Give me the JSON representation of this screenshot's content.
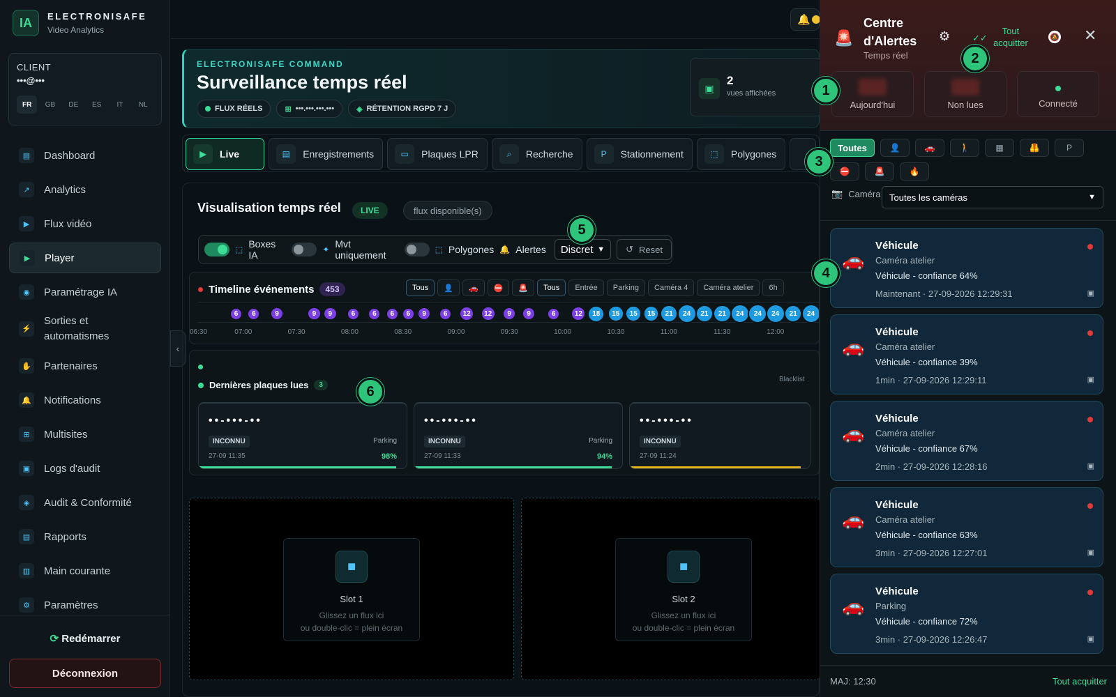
{
  "brand": {
    "logo": "IA",
    "name": "ELECTRONISAFE",
    "sub": "Video Analytics"
  },
  "client": {
    "label": "CLIENT",
    "email": "•••@•••",
    "languages": [
      "FR",
      "GB",
      "DE",
      "ES",
      "IT",
      "NL"
    ]
  },
  "nav": [
    {
      "label": "Dashboard",
      "icon": "dashboard-icon",
      "glyph": "▤"
    },
    {
      "label": "Analytics",
      "icon": "analytics-icon",
      "glyph": "↗"
    },
    {
      "label": "Flux vidéo",
      "icon": "video-icon",
      "glyph": "▶"
    },
    {
      "label": "Player",
      "icon": "play-icon",
      "glyph": "▶"
    },
    {
      "label": "Paramétrage IA",
      "icon": "brain-icon",
      "glyph": "◉"
    },
    {
      "label": "Sorties et automatismes",
      "icon": "bolt-icon",
      "glyph": "⚡"
    },
    {
      "label": "Partenaires",
      "icon": "handshake-icon",
      "glyph": "✋"
    },
    {
      "label": "Notifications",
      "icon": "bell-icon",
      "glyph": "🔔"
    },
    {
      "label": "Multisites",
      "icon": "sitemap-icon",
      "glyph": "⊞"
    },
    {
      "label": "Logs d'audit",
      "icon": "log-icon",
      "glyph": "▣"
    },
    {
      "label": "Audit & Conformité",
      "icon": "shield-icon",
      "glyph": "◈"
    },
    {
      "label": "Rapports",
      "icon": "report-icon",
      "glyph": "▤"
    },
    {
      "label": "Main courante",
      "icon": "book-icon",
      "glyph": "▥"
    },
    {
      "label": "Paramètres",
      "icon": "gear-icon",
      "glyph": "⚙"
    }
  ],
  "footer": {
    "restart": "Redémarrer",
    "logout": "Déconnexion"
  },
  "hero": {
    "kicker": "ELECTRONISAFE COMMAND",
    "title": "Surveillance temps réel",
    "chips": [
      "FLUX RÉELS",
      "•••.•••.•••.•••",
      "RÉTENTION RGPD 7 J"
    ],
    "views_count": "2",
    "views_label": "vues affichées"
  },
  "tabs": [
    {
      "label": "Live",
      "glyph": "▶"
    },
    {
      "label": "Enregistrements",
      "glyph": "▤"
    },
    {
      "label": "Plaques LPR",
      "glyph": "▭"
    },
    {
      "label": "Recherche",
      "glyph": "⌕"
    },
    {
      "label": "Stationnement",
      "glyph": "P"
    },
    {
      "label": "Polygones",
      "glyph": "⬚"
    }
  ],
  "viz": {
    "title": "Visualisation temps réel",
    "live": "LIVE",
    "flux": "flux disponible(s)"
  },
  "controls": {
    "boxes": "Boxes IA",
    "mvt": "Mvt uniquement",
    "polygones": "Polygones",
    "alertes": "Alertes",
    "mode": "Discret",
    "reset": "Reset"
  },
  "timeline": {
    "title": "Timeline événements",
    "count": "453",
    "filters": [
      "Tous",
      "👤",
      "🚗",
      "⛔",
      "🚨",
      "Tous",
      "Entrée",
      "Parking",
      "Caméra 4",
      "Caméra atelier",
      "6h"
    ],
    "ticks": [
      "06:30",
      "07:00",
      "07:30",
      "08:00",
      "08:30",
      "09:00",
      "09:30",
      "10:00",
      "10:30",
      "11:00",
      "11:30",
      "12:00"
    ],
    "events": [
      {
        "t": "06:42",
        "n": "6",
        "c": "#7b3fe4"
      },
      {
        "t": "06:52",
        "n": "6",
        "c": "#7b3fe4"
      },
      {
        "t": "07:05",
        "n": "9",
        "c": "#7b3fe4"
      },
      {
        "t": "07:26",
        "n": "9",
        "c": "#7b3fe4"
      },
      {
        "t": "07:35",
        "n": "9",
        "c": "#7b3fe4"
      },
      {
        "t": "07:48",
        "n": "6",
        "c": "#7b3fe4"
      },
      {
        "t": "08:00",
        "n": "6",
        "c": "#7b3fe4"
      },
      {
        "t": "08:10",
        "n": "6",
        "c": "#7b3fe4"
      },
      {
        "t": "08:19",
        "n": "6",
        "c": "#7b3fe4"
      },
      {
        "t": "08:28",
        "n": "9",
        "c": "#7b3fe4"
      },
      {
        "t": "08:40",
        "n": "6",
        "c": "#7b3fe4"
      },
      {
        "t": "08:52",
        "n": "12",
        "c": "#7b3fe4"
      },
      {
        "t": "09:04",
        "n": "12",
        "c": "#7b3fe4"
      },
      {
        "t": "09:16",
        "n": "9",
        "c": "#7b3fe4"
      },
      {
        "t": "09:27",
        "n": "9",
        "c": "#7b3fe4"
      },
      {
        "t": "09:41",
        "n": "6",
        "c": "#7b3fe4"
      },
      {
        "t": "09:55",
        "n": "12",
        "c": "#7b3fe4"
      },
      {
        "t": "10:05",
        "n": "18",
        "c": "#7b3fe4"
      },
      {
        "t": "10:16",
        "n": "15",
        "c": "#7b3fe4"
      },
      {
        "t": "10:26",
        "n": "15",
        "c": "#7b3fe4"
      },
      {
        "t": "10:36",
        "n": "15",
        "c": "#7b3fe4"
      },
      {
        "t": "10:46",
        "n": "21",
        "c": "#7b3fe4"
      },
      {
        "t": "10:56",
        "n": "24",
        "c": "#7b3fe4"
      },
      {
        "t": "11:06",
        "n": "21",
        "c": "#7b3fe4"
      },
      {
        "t": "11:16",
        "n": "21",
        "c": "#7b3fe4"
      },
      {
        "t": "11:26",
        "n": "24",
        "c": "#7b3fe4"
      },
      {
        "t": "11:36",
        "n": "24",
        "c": "#7b3fe4"
      },
      {
        "t": "11:46",
        "n": "24",
        "c": "#7b3fe4"
      },
      {
        "t": "11:56",
        "n": "21",
        "c": "#7b3fe4"
      },
      {
        "t": "12:06",
        "n": "24",
        "c": "#7b3fe4"
      }
    ]
  },
  "plates": {
    "title": "Dernières plaques lues",
    "count": "3",
    "blacklist": "Blacklist",
    "items": [
      {
        "plate": "••-•••-••",
        "tag": "INCONNU",
        "loc": "Parking",
        "time": "27-09 11:35",
        "conf": "98%",
        "color": "#3ddc97"
      },
      {
        "plate": "••-•••-••",
        "tag": "INCONNU",
        "loc": "Parking",
        "time": "27-09 11:33",
        "conf": "94%",
        "color": "#3ddc97"
      },
      {
        "plate": "••-•••-••",
        "tag": "INCONNU",
        "loc": "",
        "time": "27-09 11:24",
        "conf": "",
        "color": "#e0b020"
      }
    ]
  },
  "slots": [
    {
      "name": "Slot 1",
      "hint1": "Glissez un flux ici",
      "hint2": "ou double-clic = plein écran"
    },
    {
      "name": "Slot 2",
      "hint1": "Glissez un flux ici",
      "hint2": "ou double-clic = plein écran"
    }
  ],
  "alert_center": {
    "title1": "Centre",
    "title2": "d'Alertes",
    "sub": "Temps réel",
    "ack_all_1": "Tout",
    "ack_all_2": "acquitter",
    "stats": [
      "Aujourd'hui",
      "Non lues",
      "Connecté"
    ],
    "filter_all": "Toutes",
    "filters": [
      "👤",
      "🚗",
      "🚶",
      "▦",
      "🦺",
      "P",
      "⛔",
      "🚨",
      "🔥"
    ],
    "camera_label": "Caméra",
    "camera_value": "Toutes les caméras",
    "alerts": [
      {
        "title": "Véhicule",
        "camera": "Caméra atelier",
        "desc": "Véhicule - confiance 64%",
        "time": "Maintenant · 27-09-2026 12:29:31"
      },
      {
        "title": "Véhicule",
        "camera": "Caméra atelier",
        "desc": "Véhicule - confiance 39%",
        "time": "1min · 27-09-2026 12:29:11"
      },
      {
        "title": "Véhicule",
        "camera": "Caméra atelier",
        "desc": "Véhicule - confiance 67%",
        "time": "2min · 27-09-2026 12:28:16"
      },
      {
        "title": "Véhicule",
        "camera": "Caméra atelier",
        "desc": "Véhicule - confiance 63%",
        "time": "3min · 27-09-2026 12:27:01"
      },
      {
        "title": "Véhicule",
        "camera": "Parking",
        "desc": "Véhicule - confiance 72%",
        "time": "3min · 27-09-2026 12:26:47"
      }
    ],
    "footer_maj": "MAJ: 12:30",
    "footer_ack": "Tout acquitter"
  },
  "callouts": [
    "1",
    "2",
    "3",
    "4",
    "5",
    "6"
  ],
  "colors": {
    "accent": "#3ddc97",
    "alert": "#e23b3b",
    "event": "#7b3fe4"
  }
}
